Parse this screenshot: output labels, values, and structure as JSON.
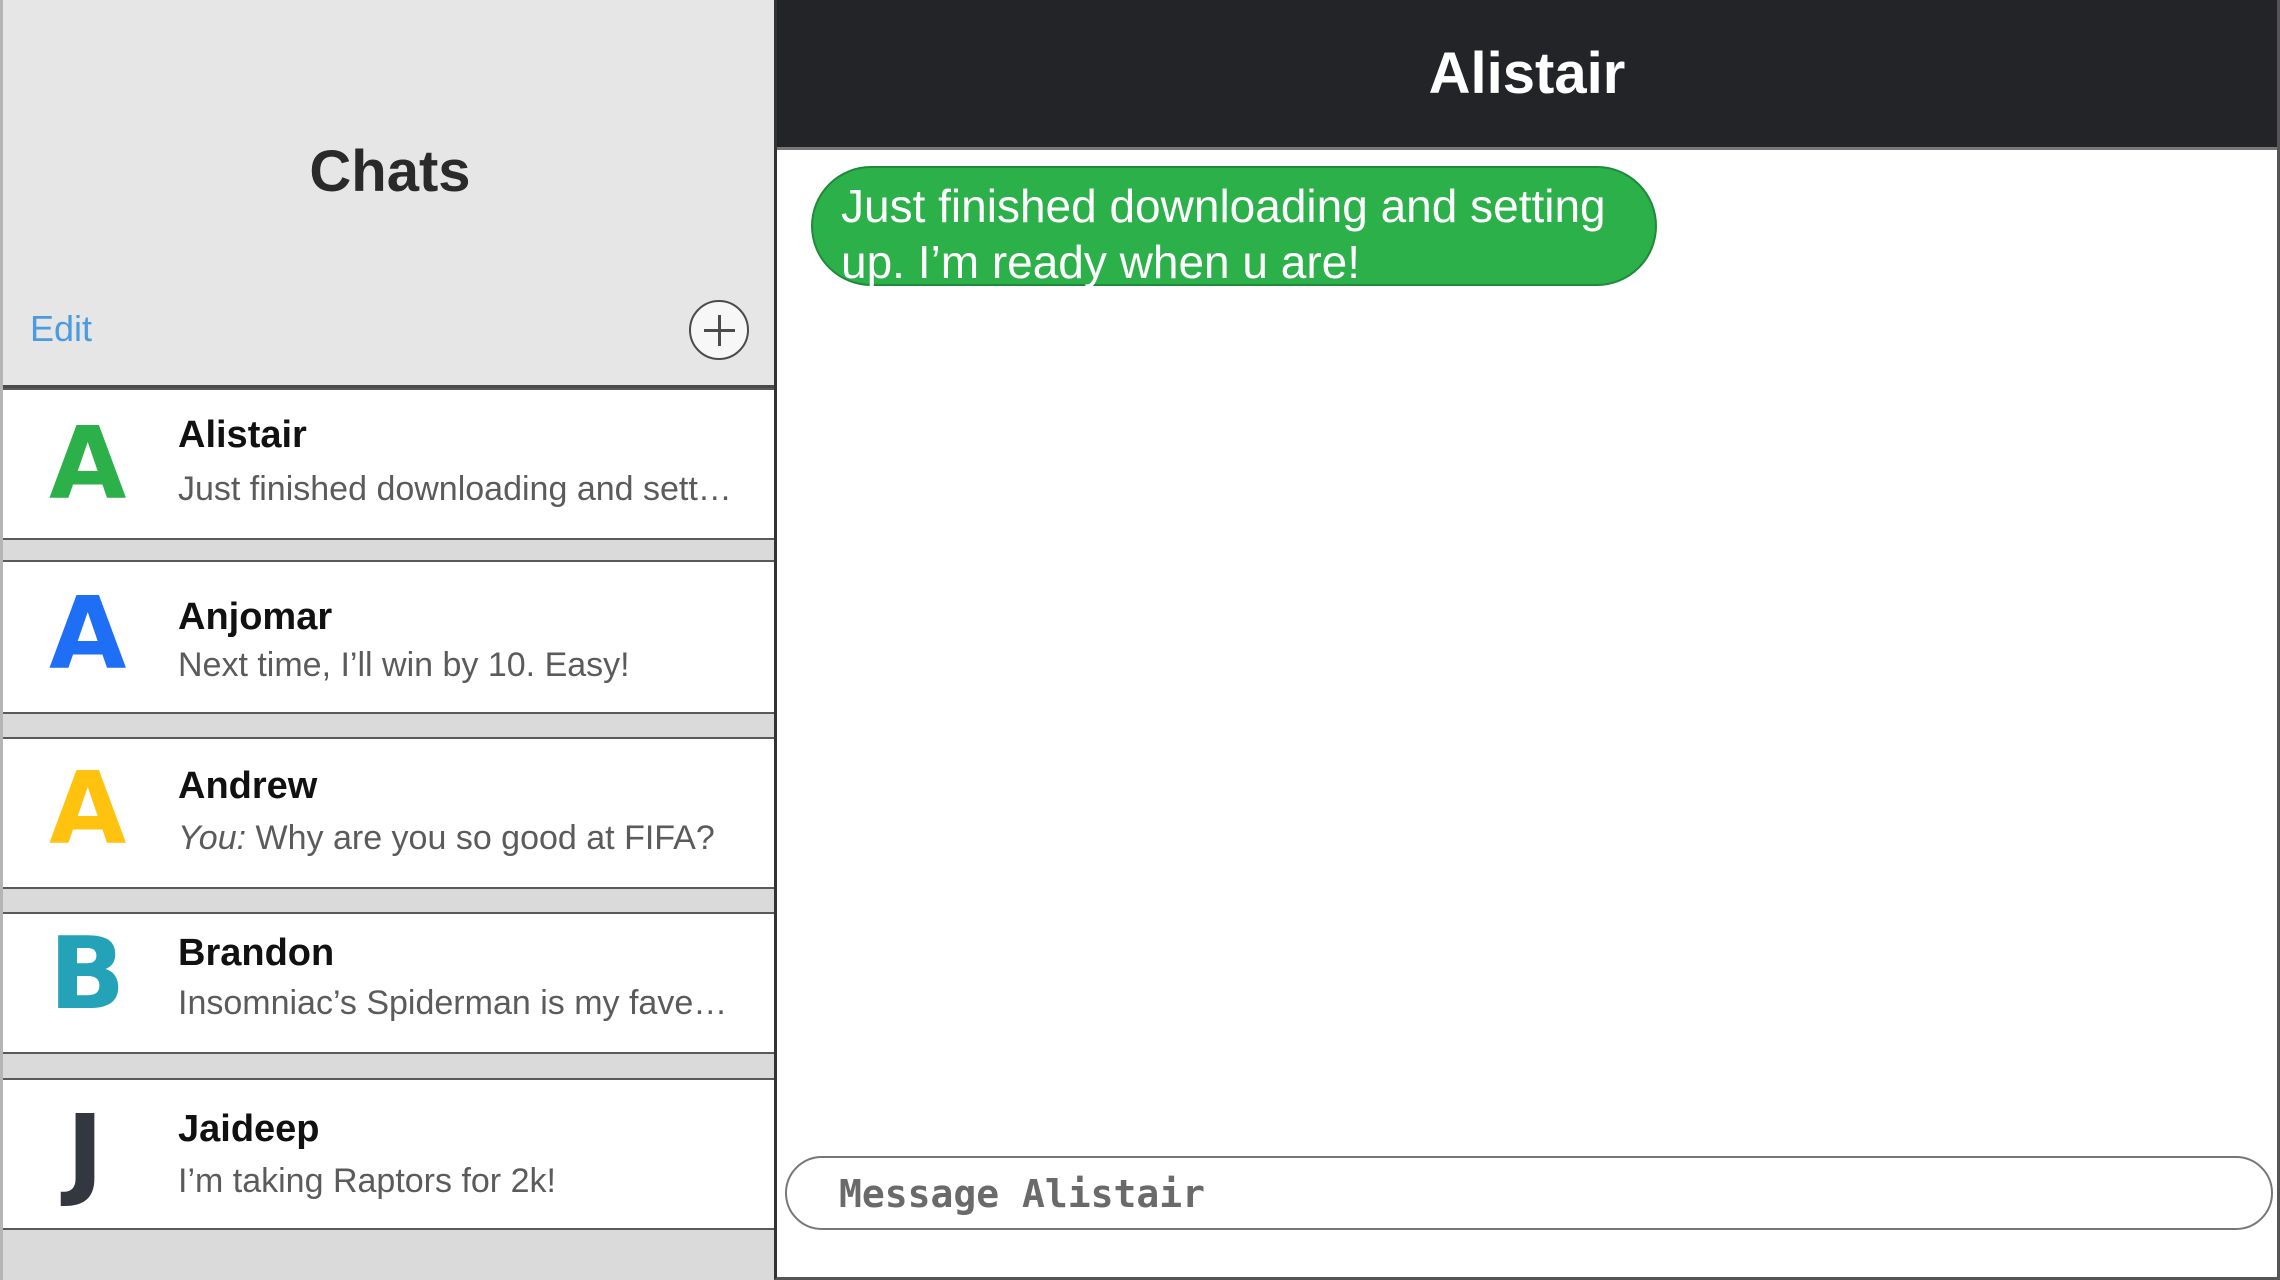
{
  "sidebar": {
    "title": "Chats",
    "edit_label": "Edit",
    "new_chat_icon": "plus-circle-icon",
    "chats": [
      {
        "initial": "A",
        "color": "#2bb04a",
        "name": "Alistair",
        "you_prefix": "",
        "preview": "Just finished downloading and sett…"
      },
      {
        "initial": "A",
        "color": "#1e6ff5",
        "name": "Anjomar",
        "you_prefix": "",
        "preview": "Next time, I’ll win by 10. Easy!"
      },
      {
        "initial": "A",
        "color": "#ffc20e",
        "name": "Andrew",
        "you_prefix": "You:",
        "preview": " Why are you so good at FIFA?"
      },
      {
        "initial": "B",
        "color": "#24a3b8",
        "name": "Brandon",
        "you_prefix": "",
        "preview": "Insomniac’s Spiderman is my fave…"
      },
      {
        "initial": "J",
        "color": "#333840",
        "name": "Jaideep",
        "you_prefix": "",
        "preview": "I’m taking Raptors for 2k!"
      }
    ]
  },
  "conversation": {
    "title": "Alistair",
    "messages": [
      {
        "text": "Just finished downloading and setting up. I’m ready when u are!",
        "color": "#2bb04a"
      }
    ],
    "composer_placeholder": "Message Alistair"
  }
}
